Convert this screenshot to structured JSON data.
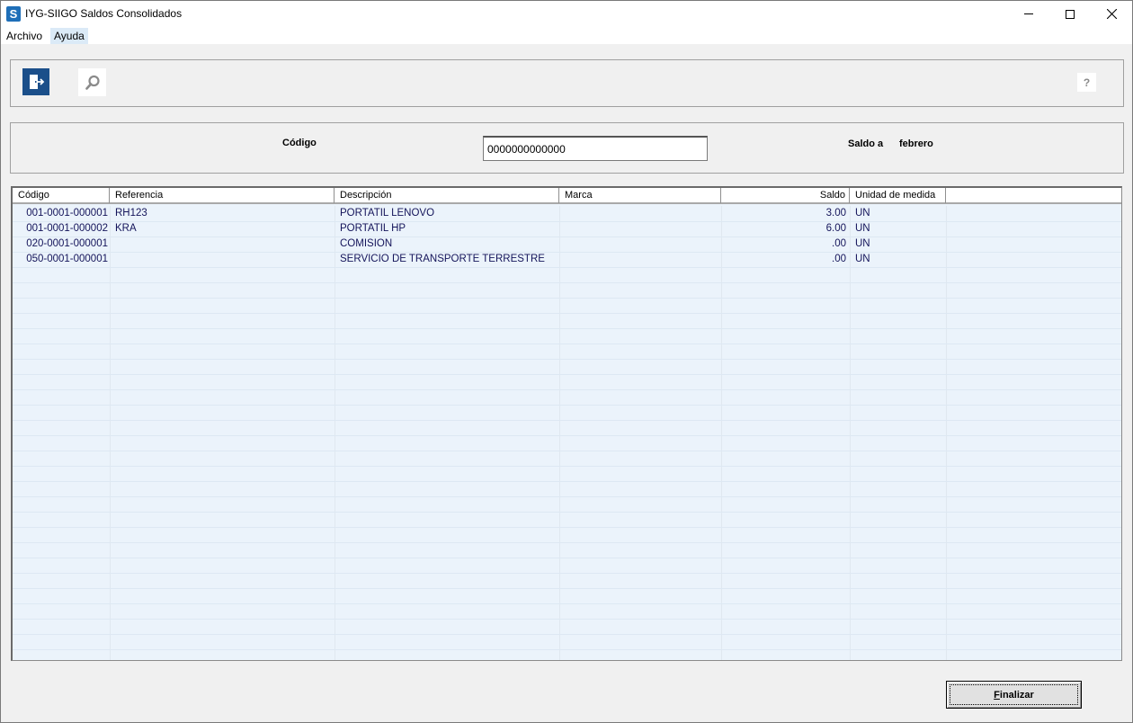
{
  "window": {
    "title": "IYG-SIIGO Saldos Consolidados",
    "app_icon_letter": "S"
  },
  "menu": {
    "archivo": "Archivo",
    "ayuda": "Ayuda"
  },
  "toolbar": {
    "help_label": "?"
  },
  "filter": {
    "codigo_label": "Código",
    "codigo_value": "0000000000000",
    "saldo_label": "Saldo a",
    "mes_value": "febrero"
  },
  "grid": {
    "columns": {
      "codigo": "Código",
      "referencia": "Referencia",
      "descripcion": "Descripción",
      "marca": "Marca",
      "saldo": "Saldo",
      "unidad": "Unidad de medida"
    },
    "rows": [
      {
        "codigo": "001-0001-000001",
        "referencia": "RH123",
        "descripcion": "PORTATIL LENOVO",
        "marca": "",
        "saldo": "3.00",
        "unidad": "UN"
      },
      {
        "codigo": "001-0001-000002",
        "referencia": "KRA",
        "descripcion": "PORTATIL HP",
        "marca": "",
        "saldo": "6.00",
        "unidad": "UN"
      },
      {
        "codigo": "020-0001-000001",
        "referencia": "",
        "descripcion": "COMISION",
        "marca": "",
        "saldo": ".00",
        "unidad": "UN"
      },
      {
        "codigo": "050-0001-000001",
        "referencia": "",
        "descripcion": "SERVICIO DE TRANSPORTE TERRESTRE",
        "marca": "",
        "saldo": ".00",
        "unidad": "UN"
      }
    ]
  },
  "footer": {
    "finalizar_accel": "F",
    "finalizar_rest": "inalizar"
  },
  "colors": {
    "accent": "#1b4f8a",
    "grid_background": "#ebf3fb",
    "row_text": "#14145a"
  }
}
